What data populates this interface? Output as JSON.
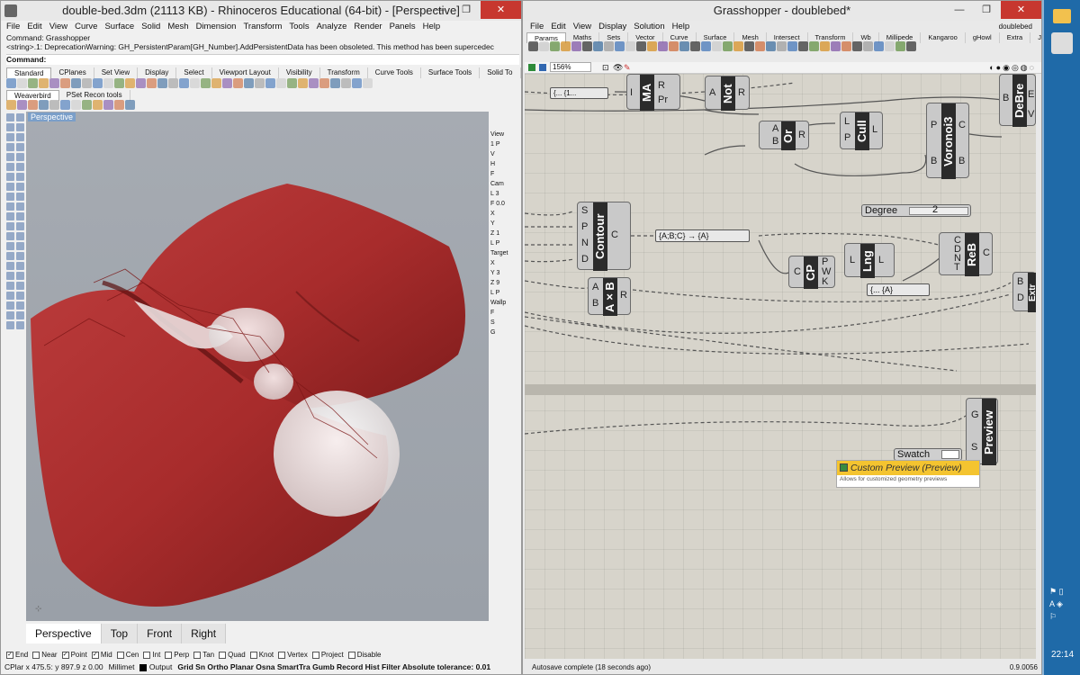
{
  "rhino": {
    "title": "double-bed.3dm (21113 KB) - Rhinoceros Educational (64-bit) - [Perspective]",
    "menu": [
      "File",
      "Edit",
      "View",
      "Curve",
      "Surface",
      "Solid",
      "Mesh",
      "Dimension",
      "Transform",
      "Tools",
      "Analyze",
      "Render",
      "Panels",
      "Help"
    ],
    "command_history": [
      "Command: Grasshopper",
      "<string>.1: DeprecationWarning: GH_PersistentParam[GH_Number].AddPersistentData has been obsoleted.  This method has been supercedec"
    ],
    "command_prompt": "Command:",
    "toolbar_tabs": [
      "Standard",
      "CPlanes",
      "Set View",
      "Display",
      "Select",
      "Viewport Layout",
      "Visibility",
      "Transform",
      "Curve Tools",
      "Surface Tools",
      "Solid To"
    ],
    "plugin_tabs": [
      "Weaverbird",
      "PSet Recon tools"
    ],
    "viewport_label": "Perspective",
    "viewport_tabs": [
      "Perspective",
      "Top",
      "Front",
      "Right"
    ],
    "right_panel": [
      "View",
      "1 P",
      "V",
      "H",
      "F",
      "Cam",
      "L 3",
      "F 0.0",
      "X",
      "Y",
      "Z 1",
      "L P",
      "Target",
      "X",
      "Y 3",
      "Z 9",
      "L P",
      "Wallp",
      "F",
      "S",
      "G"
    ],
    "osnaps": [
      {
        "label": "End",
        "checked": true
      },
      {
        "label": "Near",
        "checked": false
      },
      {
        "label": "Point",
        "checked": true
      },
      {
        "label": "Mid",
        "checked": true
      },
      {
        "label": "Cen",
        "checked": false
      },
      {
        "label": "Int",
        "checked": false
      },
      {
        "label": "Perp",
        "checked": false
      },
      {
        "label": "Tan",
        "checked": false
      },
      {
        "label": "Quad",
        "checked": false
      },
      {
        "label": "Knot",
        "checked": false
      },
      {
        "label": "Vertex",
        "checked": false
      },
      {
        "label": "Project",
        "checked": false
      },
      {
        "label": "Disable",
        "checked": false
      }
    ],
    "status": [
      "CPlar x 475.5: y 897.9 z 0.00",
      "Millimet",
      "Output",
      "Grid Sn Ortho Planar Osna SmartTra Gumb Record Hist Filter Absolute tolerance: 0.01"
    ]
  },
  "gh": {
    "title": "Grasshopper - doublebed*",
    "doc_name": "doublebed",
    "menu": [
      "File",
      "Edit",
      "View",
      "Display",
      "Solution",
      "Help"
    ],
    "tabs": [
      "Params",
      "Maths",
      "Sets",
      "Vector",
      "Curve",
      "Surface",
      "Mesh",
      "Intersect",
      "Transform",
      "Wb",
      "Millipede",
      "Kangaroo",
      "gHowl",
      "Extra",
      "JH"
    ],
    "zoom": "156%",
    "components": {
      "ma": {
        "name": "MA",
        "inputs": [
          "I"
        ],
        "outputs": [
          "R",
          "Pr"
        ]
      },
      "not": {
        "name": "Not",
        "inputs": [
          "A"
        ],
        "outputs": [
          "R"
        ]
      },
      "or": {
        "name": "Or",
        "inputs": [
          "A",
          "B"
        ],
        "outputs": [
          "R"
        ]
      },
      "cull": {
        "name": "Cull",
        "inputs": [
          "L",
          "P"
        ],
        "outputs": [
          "L"
        ]
      },
      "voronoi": {
        "name": "Voronoi3",
        "inputs": [
          "P",
          "B"
        ],
        "outputs": [
          "C",
          "B"
        ]
      },
      "debrep": {
        "name": "DeBre",
        "inputs": [
          "B"
        ],
        "outputs": [
          "E",
          "V"
        ]
      },
      "contour": {
        "name": "Contour",
        "inputs": [
          "S",
          "P",
          "N",
          "D"
        ],
        "outputs": [
          "C"
        ]
      },
      "cp": {
        "name": "CP",
        "inputs": [
          "C"
        ],
        "outputs": [
          "P",
          "W",
          "K"
        ]
      },
      "lng": {
        "name": "Lng",
        "inputs": [
          "L"
        ],
        "outputs": [
          "L"
        ]
      },
      "reb": {
        "name": "ReB",
        "inputs": [
          "C",
          "D",
          "N",
          "T"
        ],
        "outputs": [
          "C"
        ]
      },
      "axb": {
        "name": "A×B",
        "inputs": [
          "A",
          "B"
        ],
        "outputs": [
          "R"
        ]
      },
      "extr": {
        "name": "Extr",
        "inputs": [
          "B",
          "D"
        ],
        "outputs": []
      },
      "preview": {
        "name": "Preview",
        "inputs": [
          "G",
          "S"
        ],
        "outputs": []
      }
    },
    "degree_slider": {
      "label": "Degree",
      "value": "2"
    },
    "swatch_label": "Swatch",
    "panels": {
      "p1": "{... {1...",
      "p2": "{A;B;C} → {A}",
      "p3": "{... {A}"
    },
    "tooltip": {
      "title": "Custom Preview (Preview)",
      "desc": "Allows for customized geometry previews"
    },
    "status": "Autosave complete (18 seconds ago)",
    "version": "0.9.0056"
  },
  "taskbar": {
    "time": "22:14",
    "icons": [
      "folder-icon",
      "rhino-icon"
    ]
  }
}
